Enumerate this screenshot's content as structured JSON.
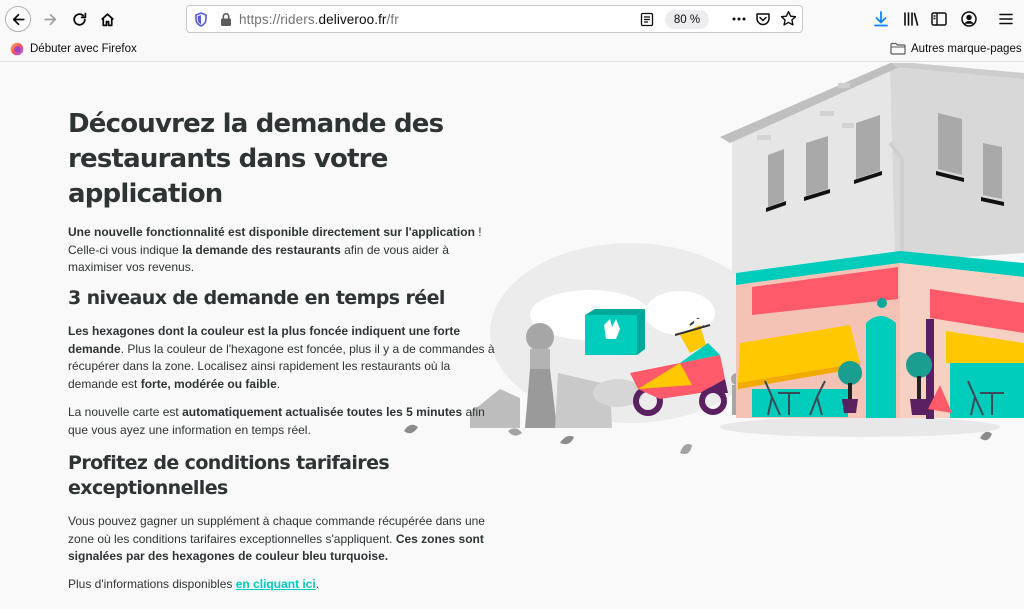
{
  "browser": {
    "url_prefix": "https://riders.",
    "url_host": "deliveroo.fr",
    "url_path": "/fr",
    "zoom": "80 %",
    "bookmarks": {
      "firefox_label": "Débuter avec Firefox",
      "other_label": "Autres marque-pages"
    }
  },
  "page": {
    "title": "Découvrez la demande des restaurants dans votre application",
    "intro": {
      "b1": "Une nouvelle fonctionnalité est disponible directement sur l'application",
      "t1": " ! Celle-ci vous indique ",
      "b2": "la demande des restaurants",
      "t2": " afin de vous aider à maximiser vos revenus."
    },
    "section1": {
      "title": "3 niveaux de demande en temps réel",
      "p1_b1": "Les hexagones dont la couleur est la plus foncée indiquent une forte demande",
      "p1_t1": ". Plus la couleur de l'hexagone est foncée, plus il y a de commandes à récupérer dans la zone. Localisez ainsi rapidement les restaurants où la demande est ",
      "p1_b2": "forte, modérée ou faible",
      "p1_t2": ".",
      "p2_t1": "La nouvelle carte est ",
      "p2_b1": "automatiquement actualisée toutes les 5 minutes",
      "p2_t2": " afin que vous ayez une information en temps réel."
    },
    "section2": {
      "title": "Profitez de conditions tarifaires exceptionnelles",
      "p1_t1": "Vous pouvez gagner un supplément à chaque commande récupérée dans une zone où les conditions tarifaires exceptionnelles s'appliquent. ",
      "p1_b1": "Ces zones sont signalées par des hexagones de couleur bleu turquoise.",
      "p2_t1": "Plus d'informations disponibles ",
      "p2_link": "en cliquant ici",
      "p2_t2": "."
    }
  },
  "colors": {
    "teal": "#00ccbc",
    "text": "#2e3333",
    "accent_blue": "#0a84ff"
  }
}
